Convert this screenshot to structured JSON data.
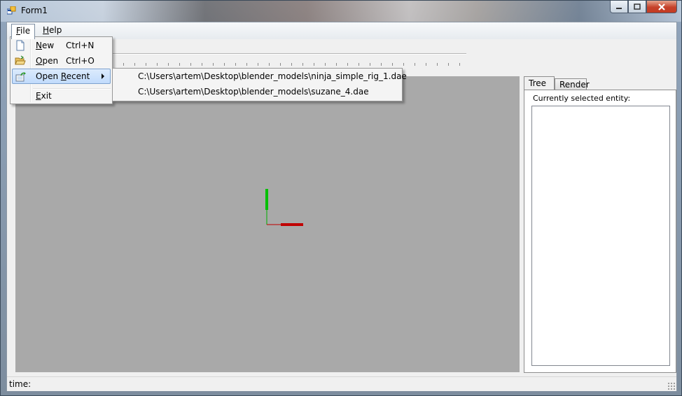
{
  "window": {
    "title": "Form1"
  },
  "menubar": {
    "file": "File",
    "help": "Help"
  },
  "file_menu": {
    "items": [
      {
        "label": "New",
        "shortcut": "Ctrl+N",
        "icon": "new-document-icon"
      },
      {
        "label": "Open",
        "shortcut": "Ctrl+O",
        "icon": "open-folder-icon"
      },
      {
        "label": "Open Recent",
        "shortcut": "",
        "icon": "open-recent-icon"
      },
      {
        "label": "Exit",
        "shortcut": ""
      }
    ]
  },
  "recent_menu": {
    "items": [
      "C:\\Users\\artem\\Desktop\\blender_models\\ninja_simple_rig_1.dae",
      "C:\\Users\\artem\\Desktop\\blender_models\\suzane_4.dae"
    ]
  },
  "side_panel": {
    "tabs": [
      "Tree",
      "Render"
    ],
    "active_tab": "Tree",
    "label": "Currently selected entity:"
  },
  "status": {
    "text": "time:"
  },
  "colors": {
    "viewport_bg": "#a9a9a9",
    "axis_x": "#c00000",
    "axis_y": "#00c000",
    "menu_highlight": "#c1dbfc"
  }
}
